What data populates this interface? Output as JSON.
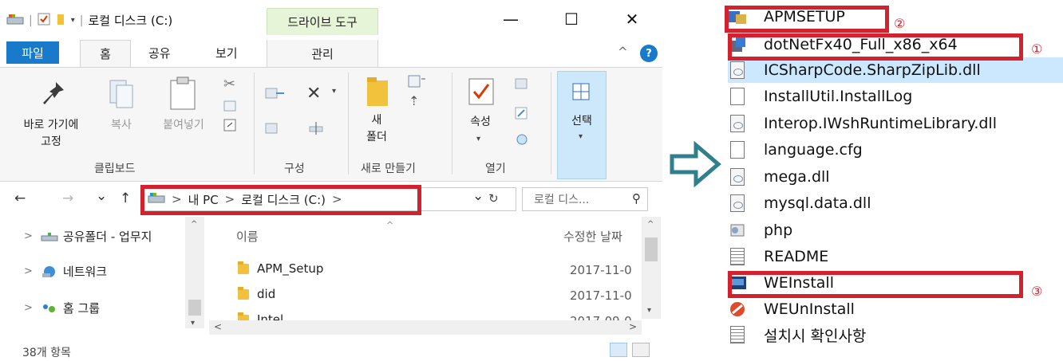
{
  "explorer": {
    "quick_access": {
      "caret": "▾",
      "sep": "|"
    },
    "title": "로컬 디스크 (C:)",
    "context_tab": "드라이브 도구",
    "window_controls": {
      "minimize": "—",
      "maximize": "☐",
      "close": "✕"
    },
    "ribbon_tabs": {
      "file": "파일",
      "home": "홈",
      "share": "공유",
      "view": "보기",
      "manage": "관리"
    },
    "help": "?",
    "collapse": "^",
    "ribbon": {
      "pin": {
        "line1": "바로 가기에",
        "line2": "고정"
      },
      "copy": "복사",
      "paste": "붙여넣기",
      "clipboard_group": "클립보드",
      "organize_group": "구성",
      "new_folder": {
        "line1": "새",
        "line2": "폴더"
      },
      "new_group": "새로 만들기",
      "properties": "속성",
      "open_group": "열기",
      "select": "선택",
      "dropdown": "▾"
    },
    "address": {
      "back": "←",
      "forward": "→",
      "recent": "⌄",
      "up": "↑",
      "crumbs": [
        "내 PC",
        "로컬 디스크 (C:)"
      ],
      "crumb_sep": ">",
      "dropdown": "⌄",
      "refresh": "↻",
      "search_placeholder": "로컬 디스...",
      "search_icon": "⚲"
    },
    "nav_items": [
      {
        "label": "공유폴더 - 업무지"
      },
      {
        "label": "네트워크"
      },
      {
        "label": "홈 그룹"
      }
    ],
    "columns": {
      "name": "이름",
      "modified": "수정한 날짜"
    },
    "files": [
      {
        "name": "APM_Setup",
        "date": "2017-11-0"
      },
      {
        "name": "did",
        "date": "2017-11-0"
      },
      {
        "name": "Intel",
        "date": "2017-09-0"
      }
    ],
    "status": "38개 항목"
  },
  "right_list": {
    "items": [
      {
        "name": "APMSETUP",
        "icon": "setup-icon"
      },
      {
        "name": "dotNetFx40_Full_x86_x64",
        "icon": "installer-icon"
      },
      {
        "name": "ICSharpCode.SharpZipLib.dll",
        "icon": "dll-icon"
      },
      {
        "name": "InstallUtil.InstallLog",
        "icon": "generic-file-icon"
      },
      {
        "name": "Interop.IWshRuntimeLibrary.dll",
        "icon": "dll-icon"
      },
      {
        "name": "language.cfg",
        "icon": "generic-file-icon"
      },
      {
        "name": "mega.dll",
        "icon": "dll-icon"
      },
      {
        "name": "mysql.data.dll",
        "icon": "dll-icon"
      },
      {
        "name": "php",
        "icon": "php-icon"
      },
      {
        "name": "README",
        "icon": "text-file-icon"
      },
      {
        "name": "WEInstall",
        "icon": "weinstall-icon"
      },
      {
        "name": "WEUnInstall",
        "icon": "weuninstall-icon"
      },
      {
        "name": "설치시 확인사항",
        "icon": "text-file-icon"
      }
    ],
    "markers": {
      "first": "①",
      "second": "②",
      "third": "③"
    }
  },
  "colors": {
    "highlight_red": "#d3212d",
    "accent_blue": "#1979ca",
    "selection": "#cce8ff",
    "arrow": "#2f7f8c"
  }
}
